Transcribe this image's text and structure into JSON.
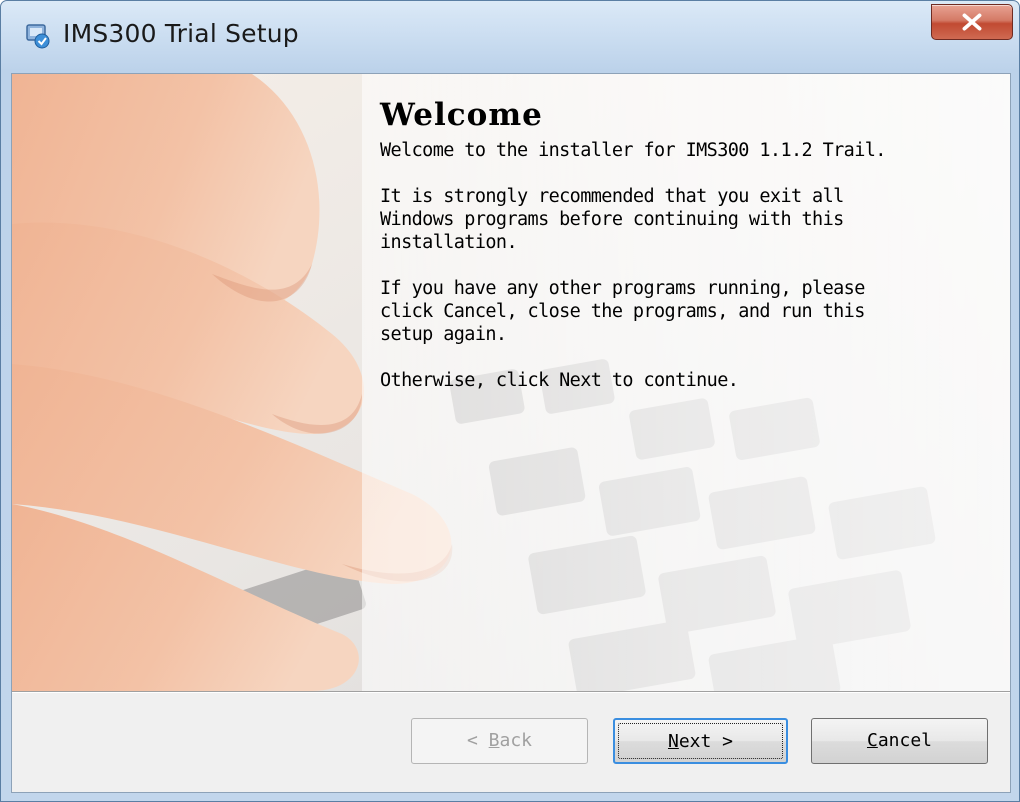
{
  "window": {
    "title": "IMS300 Trial Setup",
    "icon": "installer-icon",
    "close_icon": "close-icon"
  },
  "welcome": {
    "heading": "Welcome",
    "intro": "Welcome to the installer for IMS300 1.1.2 Trail.",
    "recommend": "It is strongly recommended that you exit all\nWindows programs before continuing with this\ninstallation.",
    "running": "If you have any other programs running, please\nclick Cancel, close the programs, and run this\nsetup again.",
    "otherwise": "Otherwise, click Next to continue."
  },
  "buttons": {
    "back": {
      "prefix": "< ",
      "mnemonic": "B",
      "rest": "ack",
      "enabled": false
    },
    "next": {
      "mnemonic": "N",
      "rest": "ext >",
      "default": true
    },
    "cancel": {
      "mnemonic": "C",
      "rest": "ancel"
    }
  },
  "colors": {
    "title_bar": "#c9dcf0",
    "close_button": "#c14a32",
    "focus_border": "#3a8ee0",
    "dialog_bg": "#f0f0f0"
  }
}
